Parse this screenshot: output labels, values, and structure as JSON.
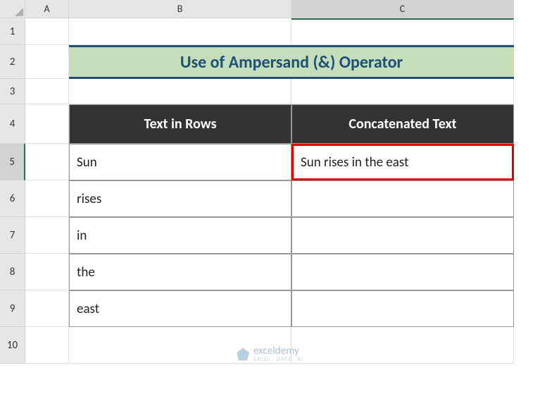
{
  "columns": {
    "corner": "",
    "A": "A",
    "B": "B",
    "C": "C"
  },
  "rows": [
    "1",
    "2",
    "3",
    "4",
    "5",
    "6",
    "7",
    "8",
    "9",
    "10"
  ],
  "title": "Use of Ampersand (&) Operator",
  "headers": {
    "col1": "Text in Rows",
    "col2": "Concatenated Text"
  },
  "data": {
    "b5": "Sun",
    "b6": "rises",
    "b7": "in",
    "b8": "the",
    "b9": "east",
    "c5": "Sun rises in the east"
  },
  "watermark": {
    "name": "exceldemy",
    "tagline": "EXCEL · DATA · BI"
  },
  "chart_data": {
    "type": "table",
    "title": "Use of Ampersand (&) Operator",
    "columns": [
      "Text in Rows",
      "Concatenated Text"
    ],
    "rows": [
      [
        "Sun",
        "Sun rises in the east"
      ],
      [
        "rises",
        ""
      ],
      [
        "in",
        ""
      ],
      [
        "the",
        ""
      ],
      [
        "east",
        ""
      ]
    ]
  }
}
